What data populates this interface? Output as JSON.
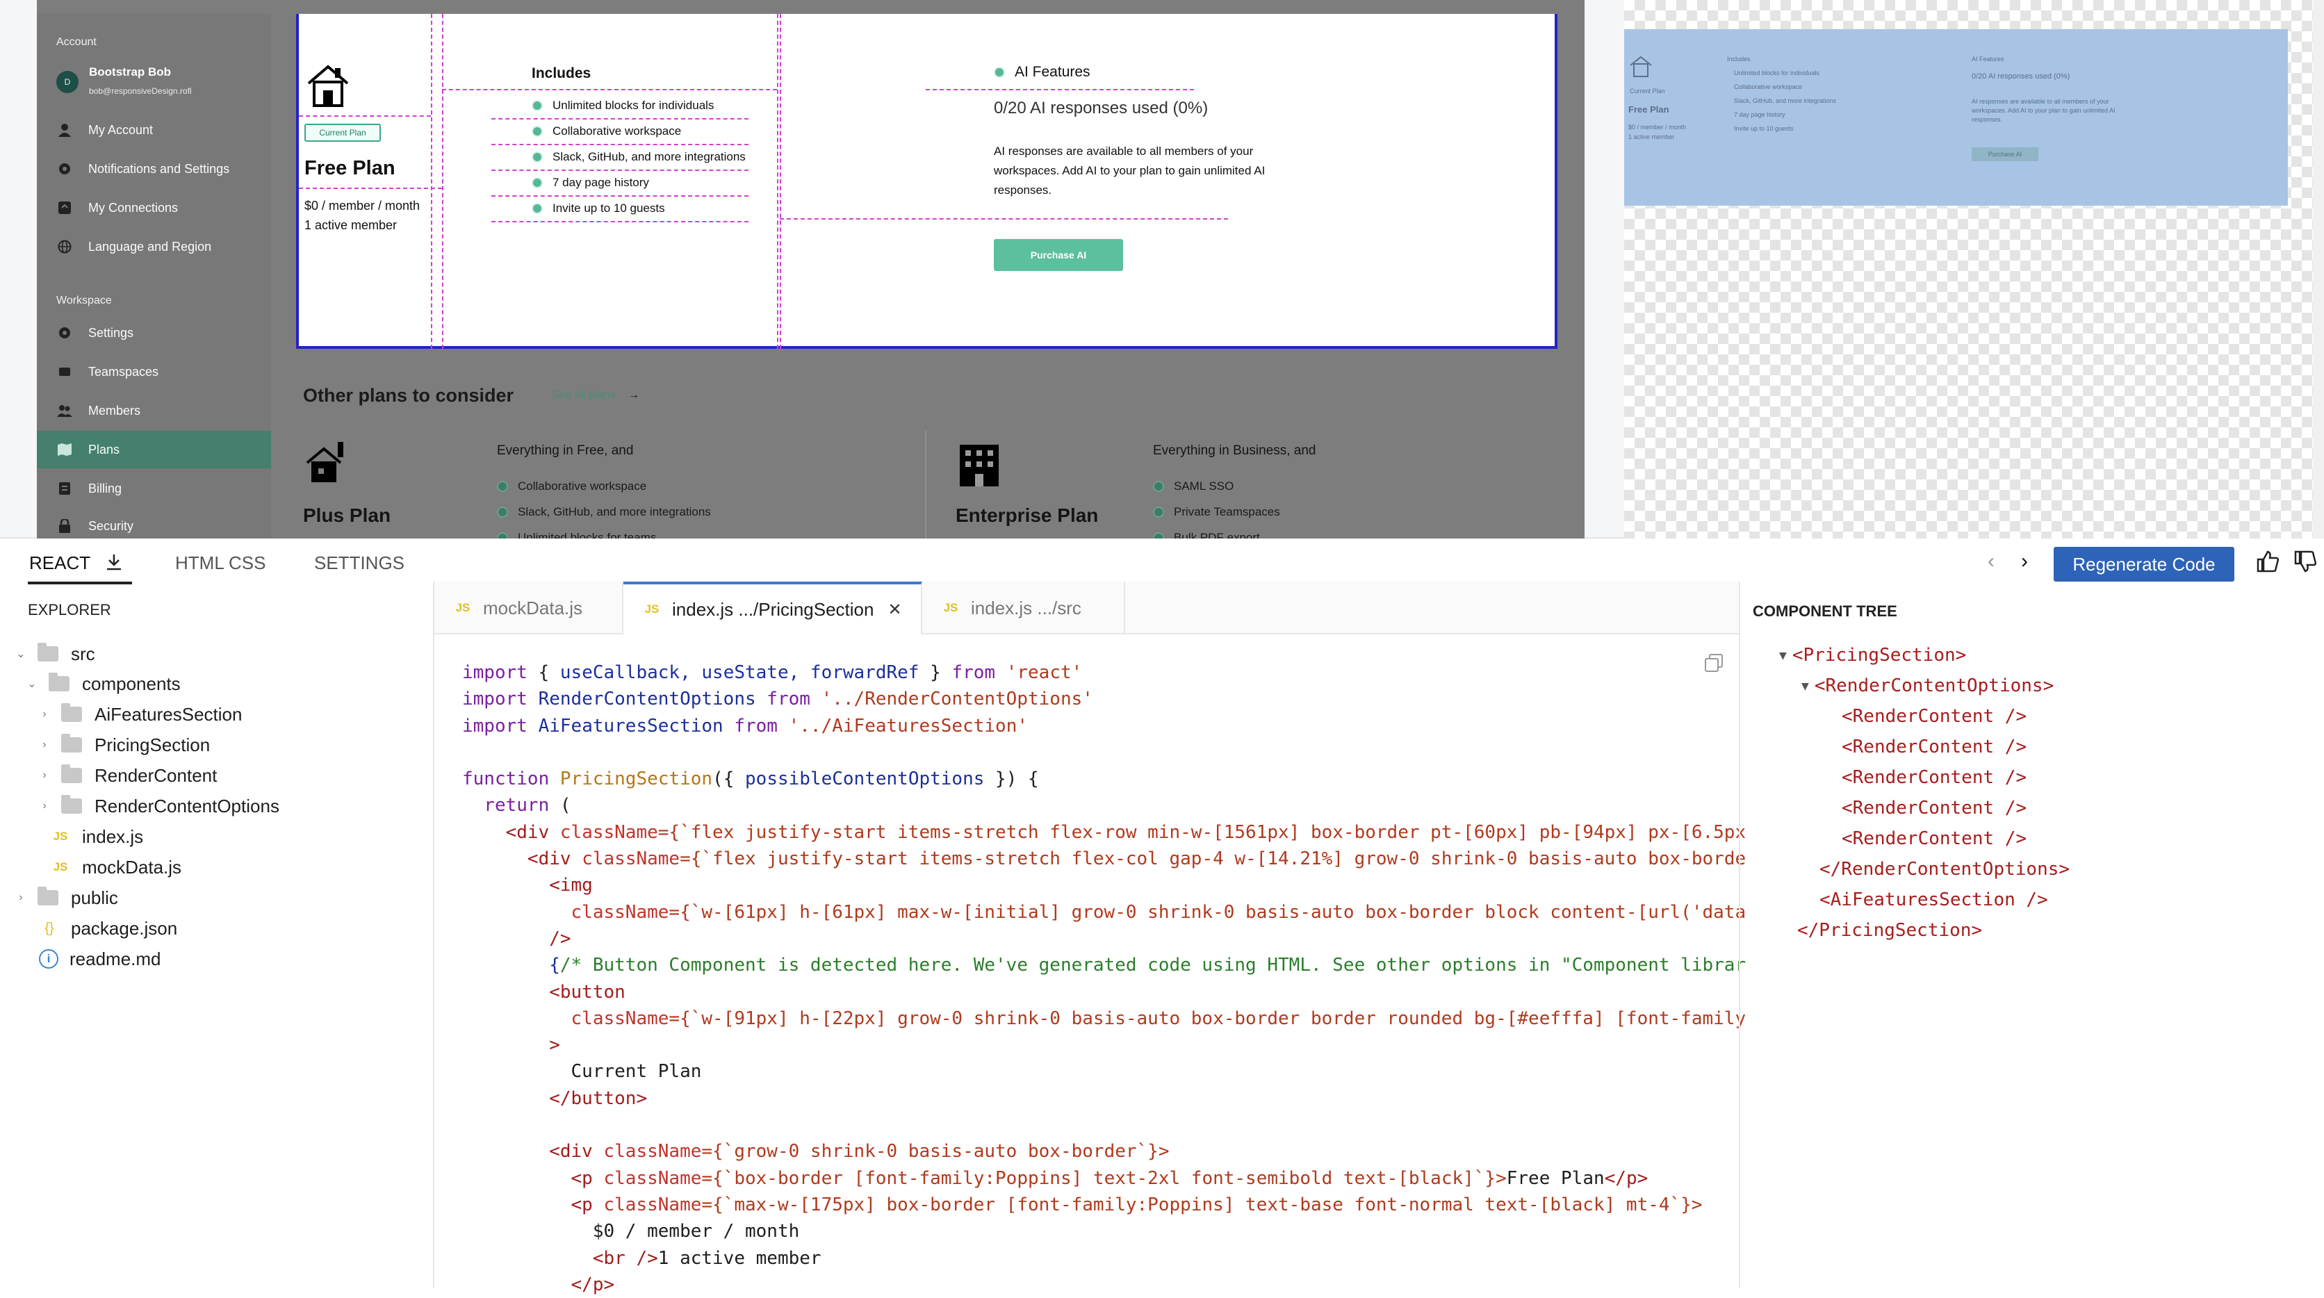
{
  "preview": {
    "sidebar": {
      "account_label": "Account",
      "user": {
        "initial": "D",
        "name": "Bootstrap Bob",
        "email": "bob@responsiveDesign.rofl"
      },
      "account_items": [
        "My Account",
        "Notifications and Settings",
        "My Connections",
        "Language and Region"
      ],
      "workspace_label": "Workspace",
      "workspace_items": [
        "Settings",
        "Teamspaces",
        "Members",
        "Plans",
        "Billing",
        "Security"
      ],
      "active_item": "Plans"
    },
    "current_plan": {
      "badge": "Current Plan",
      "name": "Free Plan",
      "price": "$0 / member / month",
      "members": "1 active member",
      "includes_title": "Includes",
      "features": [
        "Unlimited blocks for individuals",
        "Collaborative workspace",
        "Slack, GitHub, and more integrations",
        "7 day page history",
        "Invite up to 10 guests"
      ],
      "ai": {
        "title": "AI Features",
        "usage": "0/20 AI responses used (0%)",
        "description": "AI responses are available to all members of your workspaces. Add AI to your plan to gain unlimited AI responses.",
        "button": "Purchase AI"
      }
    },
    "other": {
      "title": "Other plans to consider",
      "see_all": "See all plans",
      "plans": [
        {
          "name": "Plus Plan",
          "heading": "Everything in Free, and",
          "features": [
            "Collaborative workspace",
            "Slack, GitHub, and more integrations",
            "Unlimited blocks for teams"
          ]
        },
        {
          "name": "Enterprise Plan",
          "heading": "Everything in Business, and",
          "features": [
            "SAML SSO",
            "Private Teamspaces",
            "Bulk PDF export"
          ]
        }
      ]
    }
  },
  "ide": {
    "tabs": [
      "REACT",
      "HTML CSS",
      "SETTINGS"
    ],
    "regenerate": "Regenerate Code",
    "explorer": {
      "title": "EXPLORER",
      "rows": [
        "src",
        "components",
        "AiFeaturesSection",
        "PricingSection",
        "RenderContent",
        "RenderContentOptions",
        "index.js",
        "mockData.js",
        "public",
        "package.json",
        "readme.md"
      ]
    },
    "editor_tabs": [
      "mockData.js",
      "index.js .../PricingSection",
      "index.js .../src"
    ],
    "code": {
      "l1a": "import",
      "l1b": " { ",
      "l1c": "useCallback, useState, forwardRef",
      "l1d": " } ",
      "l1e": "from",
      "l1f": " 'react'",
      "l2a": "import",
      "l2b": " RenderContentOptions ",
      "l2c": "from",
      "l2d": " '../RenderContentOptions'",
      "l3a": "import",
      "l3b": " AiFeaturesSection ",
      "l3c": "from",
      "l3d": " '../AiFeaturesSection'",
      "l5a": "function",
      "l5b": " PricingSection",
      "l5c": "({ ",
      "l5d": "possibleContentOptions",
      "l5e": " }) {",
      "l6a": "  return",
      "l6b": " (",
      "l7a": "    <div",
      "l7b": " className",
      "l7c": "={`flex justify-start items-stretch flex-row min-w-[1561px] box-border pt-[60px] pb-[94px] px-[6.5px",
      "l8a": "      <div",
      "l8b": " className",
      "l8c": "={`flex justify-start items-stretch flex-col gap-4 w-[14.21%] grow-0 shrink-0 basis-auto box-borde",
      "l9": "        <img",
      "l10a": "          className",
      "l10b": "={`w-[61px] h-[61px] max-w-[initial] grow-0 shrink-0 basis-auto box-border block content-[url('data",
      "l11": "        />",
      "l12a": "        {",
      "l12b": "/* Button Component is detected here. We've generated code using HTML. See other options in \"Component librar",
      "l13": "        <button",
      "l14a": "          className",
      "l14b": "={`w-[91px] h-[22px] grow-0 shrink-0 basis-auto box-border border rounded bg-[#eefffa] [font-family",
      "l15": "        >",
      "l16": "          Current Plan",
      "l17": "        </button>",
      "l19a": "        <div",
      "l19b": " className",
      "l19c": "={`grow-0 shrink-0 basis-auto box-border`}>",
      "l20a": "          <p",
      "l20b": " className",
      "l20c": "={`box-border [font-family:Poppins] text-2xl font-semibold text-[black]`}>",
      "l20d": "Free Plan",
      "l20e": "</p>",
      "l21a": "          <p",
      "l21b": " className",
      "l21c": "={`max-w-[175px] box-border [font-family:Poppins] text-base font-normal text-[black] mt-4`}>",
      "l22": "            $0 / member / month",
      "l23a": "            <br />",
      "l23b": "1 active member",
      "l24": "          </p>"
    },
    "component_tree": {
      "title": "COMPONENT TREE",
      "rows": [
        "<PricingSection>",
        "<RenderContentOptions>",
        "<RenderContent />",
        "<RenderContent />",
        "<RenderContent />",
        "<RenderContent />",
        "<RenderContent />",
        "</RenderContentOptions>",
        "<AiFeaturesSection />",
        "</PricingSection>"
      ]
    }
  }
}
